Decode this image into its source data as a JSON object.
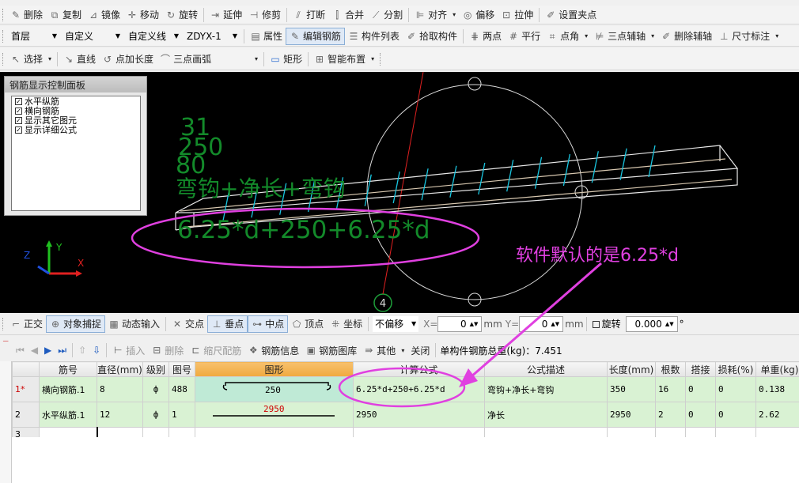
{
  "toolbar1": {
    "items": [
      {
        "label": "删除",
        "icon": "delete-icon"
      },
      {
        "label": "复制",
        "icon": "copy-icon"
      },
      {
        "label": "镜像",
        "icon": "mirror-icon"
      },
      {
        "label": "移动",
        "icon": "move-icon"
      },
      {
        "label": "旋转",
        "icon": "rotate-icon"
      },
      {
        "label": "延伸",
        "icon": "extend-icon"
      },
      {
        "label": "修剪",
        "icon": "trim-icon"
      },
      {
        "label": "打断",
        "icon": "break-icon"
      },
      {
        "label": "合并",
        "icon": "merge-icon"
      },
      {
        "label": "分割",
        "icon": "split-icon"
      },
      {
        "label": "对齐",
        "icon": "align-icon"
      },
      {
        "label": "偏移",
        "icon": "offset-icon"
      },
      {
        "label": "拉伸",
        "icon": "stretch-icon"
      },
      {
        "label": "设置夹点",
        "icon": "grip-point-icon"
      }
    ]
  },
  "toolbar2": {
    "floor": "首层",
    "type": "自定义",
    "subtype": "自定义线",
    "element": "ZDYX-1",
    "property": "属性",
    "edit_rebar": "编辑钢筋",
    "component_list": "构件列表",
    "pick": "拾取构件",
    "two_point": "两点",
    "parallel": "平行",
    "point_angle": "点角",
    "three_point_aux": "三点辅轴",
    "delete_aux": "删除辅轴",
    "dimension": "尺寸标注"
  },
  "toolbar3": {
    "select": "选择",
    "line": "直线",
    "point_length": "点加长度",
    "arc": "三点画弧",
    "rect": "矩形",
    "smart": "智能布置"
  },
  "panel": {
    "title": "钢筋显示控制面板",
    "options": [
      "水平纵筋",
      "横向钢筋",
      "显示其它图元",
      "显示详细公式"
    ]
  },
  "viewport": {
    "text_a": "31",
    "text_b": "250",
    "text_c": "80",
    "formula_label": "弯钩+净长+弯钩",
    "formula": "6.25*d+250+6.25*d",
    "note": "软件默认的是6.25*d",
    "axis_marker": "4",
    "axis_x": "X",
    "axis_y": "Y",
    "axis_z": "Z"
  },
  "snapbar": {
    "ortho": "正交",
    "snap": "对象捕捉",
    "dynamic": "动态输入",
    "intersect": "交点",
    "perp": "垂点",
    "mid": "中点",
    "vertex": "顶点",
    "coord": "坐标",
    "offset_mode": "不偏移",
    "x_label": "X=",
    "x_value": "0",
    "unit1": "mm",
    "y_label": "Y=",
    "y_value": "0",
    "unit2": "mm",
    "rotate": "旋转",
    "rotate_value": "0.000",
    "degree": "°"
  },
  "tablebar": {
    "insert": "插入",
    "delete": "删除",
    "scale": "缩尺配筋",
    "info": "钢筋信息",
    "library": "钢筋图库",
    "other": "其他",
    "close": "关闭",
    "total": "单构件钢筋总重(kg)：7.451"
  },
  "table": {
    "headers": [
      "筋号",
      "直径(mm)",
      "级别",
      "图号",
      "图形",
      "计算公式",
      "公式描述",
      "长度(mm)",
      "根数",
      "搭接",
      "损耗(%)",
      "单重(kg)"
    ],
    "rows": [
      {
        "rn": "1*",
        "name": "横向钢筋.1",
        "dia": "8",
        "grade": "ф",
        "fig": "488",
        "shape": "250",
        "formula": "6.25*d+250+6.25*d",
        "desc": "弯钩+净长+弯钩",
        "len": "350",
        "count": "16",
        "lap": "0",
        "loss": "0",
        "w": "0.138"
      },
      {
        "rn": "2",
        "name": "水平纵筋.1",
        "dia": "12",
        "grade": "ф",
        "fig": "1",
        "shape": "2950",
        "formula": "2950",
        "desc": "净长",
        "len": "2950",
        "count": "2",
        "lap": "0",
        "loss": "0",
        "w": "2.62"
      },
      {
        "rn": "3",
        "name": "",
        "dia": "",
        "grade": "",
        "fig": "",
        "shape": "",
        "formula": "",
        "desc": "",
        "len": "",
        "count": "",
        "lap": "",
        "loss": "",
        "w": ""
      }
    ]
  }
}
